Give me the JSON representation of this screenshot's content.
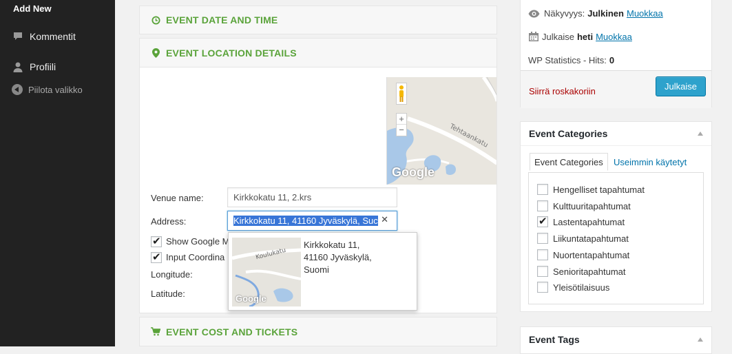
{
  "sidebar": {
    "add_new": "Add New",
    "items": [
      {
        "label": "Kommentit",
        "icon": "comment-icon"
      },
      {
        "label": "Profiili",
        "icon": "user-icon"
      }
    ],
    "collapse": "Piilota valikko"
  },
  "sections": {
    "date_time": "EVENT DATE AND TIME",
    "location": "EVENT LOCATION DETAILS",
    "cost": "EVENT COST AND TICKETS"
  },
  "location": {
    "venue_label": "Venue name:",
    "venue_value": "Kirkkokatu 11, 2.krs",
    "address_label": "Address:",
    "address_value": "Kirkkokatu 11, 41160 Jyväskylä, Suc",
    "clear_symbol": "✕",
    "show_map_label": "Show Google M",
    "show_map_checked": true,
    "input_coords_label": "Input Coordina",
    "input_coords_checked": true,
    "longitude_label": "Longitude:",
    "latitude_label": "Latitude:",
    "map_street": "Tehtaankatu",
    "map_brand": "Google",
    "zoom_in": "+",
    "zoom_out": "−"
  },
  "suggestion": {
    "lines": [
      "Kirkkokatu 11,",
      "41160 Jyväskylä,",
      "Suomi"
    ],
    "thumb_street": "Koulukatu",
    "thumb_brand": "Google"
  },
  "publish": {
    "visibility_label": "Näkyvyys:",
    "visibility_value": "Julkinen",
    "visibility_edit": "Muokkaa",
    "publish_label": "Julkaise",
    "publish_value": "heti",
    "publish_edit": "Muokkaa",
    "stats_label": "WP Statistics - Hits:",
    "stats_value": "0",
    "trash": "Siirrä roskakoriin",
    "publish_button": "Julkaise"
  },
  "categories": {
    "title": "Event Categories",
    "tab_all": "Event Categories",
    "tab_popular": "Useimmin käytetyt",
    "items": [
      {
        "label": "Hengelliset tapahtumat",
        "checked": false
      },
      {
        "label": "Kulttuuritapahtumat",
        "checked": false
      },
      {
        "label": "Lastentapahtumat",
        "checked": true
      },
      {
        "label": "Liikuntatapahtumat",
        "checked": false
      },
      {
        "label": "Nuortentapahtumat",
        "checked": false
      },
      {
        "label": "Senioritapahtumat",
        "checked": false
      },
      {
        "label": "Yleisötilaisuus",
        "checked": false
      }
    ]
  },
  "tags": {
    "title": "Event Tags"
  },
  "colors": {
    "accent_green": "#5aa33a",
    "link_blue": "#0073aa",
    "button_blue": "#2ea2cc",
    "trash_red": "#aa0000"
  }
}
